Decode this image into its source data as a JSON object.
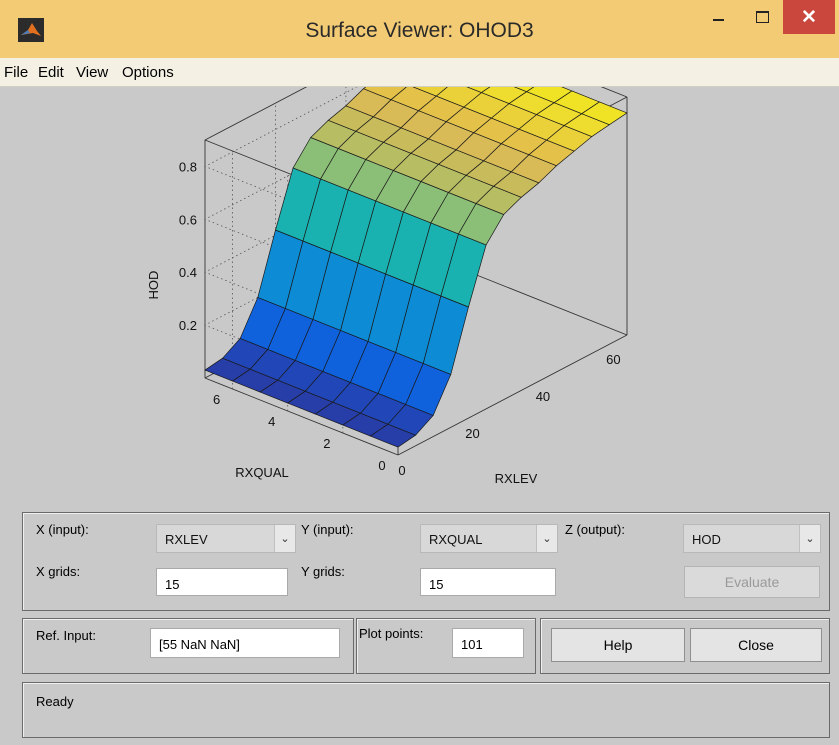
{
  "window": {
    "title": "Surface Viewer: OHOD3",
    "icon": "matlab-logo-icon",
    "controls": {
      "minimize": "–",
      "maximize": "☐",
      "close": "✕"
    },
    "titlebar_color": "#f2cb74",
    "close_color": "#c9473d"
  },
  "menu": [
    "File",
    "Edit",
    "View",
    "Options"
  ],
  "plot": {
    "z_label": "HOD",
    "x_label": "RXLEV",
    "y_label": "RXQUAL",
    "z_ticks": [
      "0.2",
      "0.4",
      "0.6",
      "0.8"
    ],
    "x_ticks": [
      "0",
      "20",
      "40",
      "60"
    ],
    "y_ticks": [
      "0",
      "2",
      "4",
      "6"
    ]
  },
  "controls": {
    "x_input_label": "X (input):",
    "x_input_value": "RXLEV",
    "y_input_label": "Y (input):",
    "y_input_value": "RXQUAL",
    "z_output_label": "Z (output):",
    "z_output_value": "HOD",
    "x_grids_label": "X grids:",
    "x_grids_value": "15",
    "y_grids_label": "Y grids:",
    "y_grids_value": "15",
    "evaluate_label": "Evaluate",
    "ref_input_label": "Ref. Input:",
    "ref_input_value": "[55 NaN NaN]",
    "plot_points_label": "Plot points:",
    "plot_points_value": "101",
    "help_label": "Help",
    "close_label": "Close"
  },
  "status": "Ready",
  "chart_data": {
    "type": "surface",
    "x": [
      0,
      5,
      10,
      15,
      20,
      25,
      30,
      35,
      40,
      45,
      50,
      55,
      60,
      65
    ],
    "y": [
      0,
      1,
      2,
      3,
      4,
      5,
      6,
      7
    ],
    "z_by_x": [
      0.03,
      0.04,
      0.08,
      0.2,
      0.42,
      0.62,
      0.7,
      0.73,
      0.75,
      0.78,
      0.8,
      0.82,
      0.83,
      0.84
    ],
    "xlabel": "RXLEV",
    "ylabel": "RXQUAL",
    "zlabel": "HOD",
    "xlim": [
      0,
      65
    ],
    "ylim": [
      0,
      7
    ],
    "zlim": [
      0,
      0.9
    ],
    "colormap": "parula",
    "grid": true
  }
}
